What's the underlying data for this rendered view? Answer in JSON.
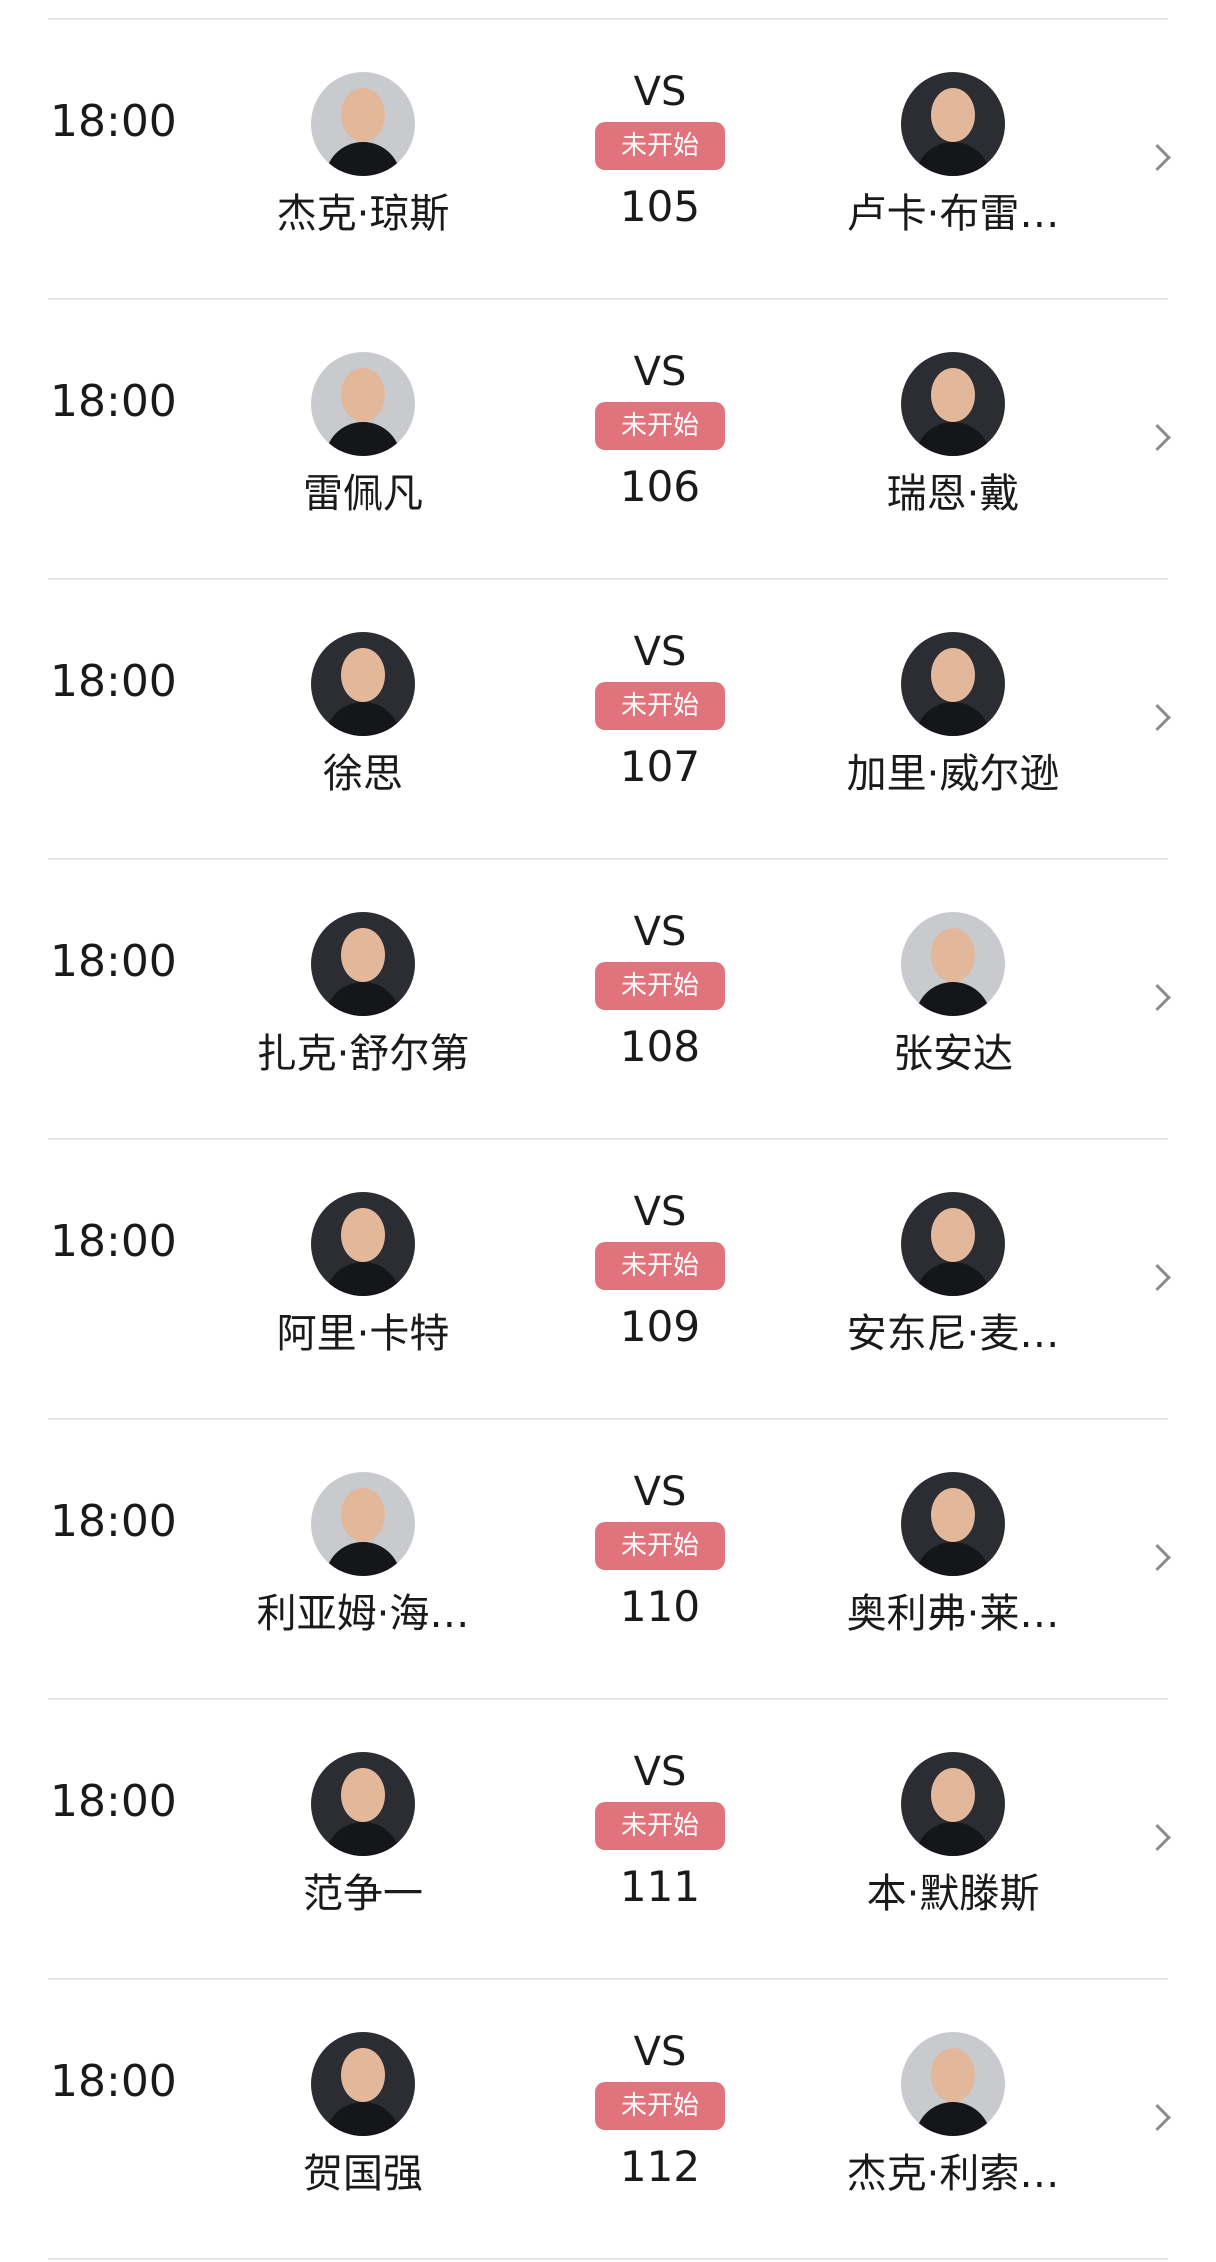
{
  "matches": [
    {
      "time": "18:00",
      "home": {
        "name": "杰克·琼斯"
      },
      "vs": "VS",
      "status": "未开始",
      "number": "105",
      "away": {
        "name": "卢卡·布雷…"
      }
    },
    {
      "time": "18:00",
      "home": {
        "name": "雷佩凡"
      },
      "vs": "VS",
      "status": "未开始",
      "number": "106",
      "away": {
        "name": "瑞恩·戴"
      }
    },
    {
      "time": "18:00",
      "home": {
        "name": "徐思"
      },
      "vs": "VS",
      "status": "未开始",
      "number": "107",
      "away": {
        "name": "加里·威尔逊"
      }
    },
    {
      "time": "18:00",
      "home": {
        "name": "扎克·舒尔第"
      },
      "vs": "VS",
      "status": "未开始",
      "number": "108",
      "away": {
        "name": "张安达"
      }
    },
    {
      "time": "18:00",
      "home": {
        "name": "阿里·卡特"
      },
      "vs": "VS",
      "status": "未开始",
      "number": "109",
      "away": {
        "name": "安东尼·麦…"
      }
    },
    {
      "time": "18:00",
      "home": {
        "name": "利亚姆·海…"
      },
      "vs": "VS",
      "status": "未开始",
      "number": "110",
      "away": {
        "name": "奥利弗·莱…"
      }
    },
    {
      "time": "18:00",
      "home": {
        "name": "范争一"
      },
      "vs": "VS",
      "status": "未开始",
      "number": "111",
      "away": {
        "name": "本·默滕斯"
      }
    },
    {
      "time": "18:00",
      "home": {
        "name": "贺国强"
      },
      "vs": "VS",
      "status": "未开始",
      "number": "112",
      "away": {
        "name": "杰克·利索…"
      }
    }
  ],
  "colors": {
    "status_badge": "#e0737b",
    "divider": "#e6e6e6",
    "chevron": "#8a8a8a"
  },
  "icons": {
    "row_action": "chevron-right-icon",
    "player_photo": "avatar"
  }
}
